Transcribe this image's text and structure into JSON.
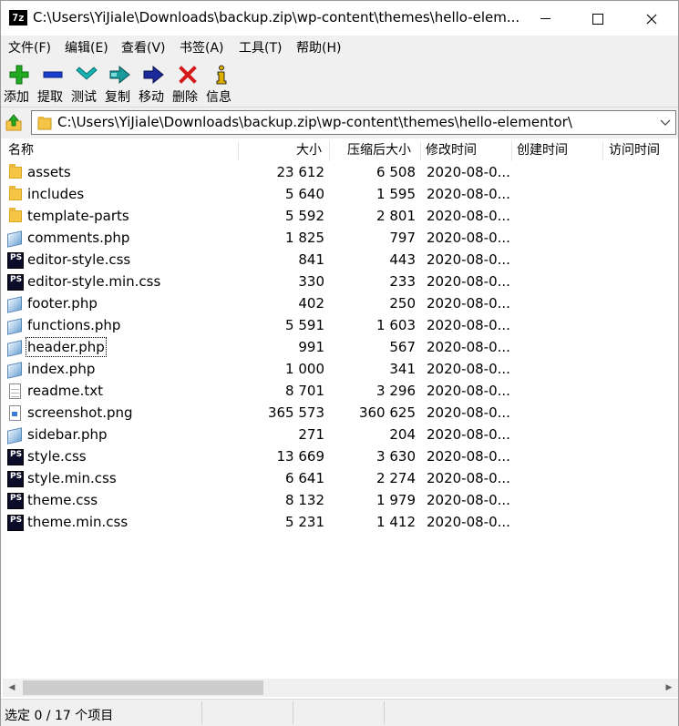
{
  "window": {
    "title": "C:\\Users\\YiJiale\\Downloads\\backup.zip\\wp-content\\themes\\hello-elem...",
    "app_icon_text": "7z"
  },
  "menu": [
    "文件(F)",
    "编辑(E)",
    "查看(V)",
    "书签(A)",
    "工具(T)",
    "帮助(H)"
  ],
  "toolbar": [
    {
      "label": "添加",
      "icon": "add-icon",
      "color": "#22aa22"
    },
    {
      "label": "提取",
      "icon": "extract-icon",
      "color": "#1a3fcf"
    },
    {
      "label": "测试",
      "icon": "test-icon",
      "color": "#17b3b3"
    },
    {
      "label": "复制",
      "icon": "copy-icon",
      "color": "#1a8a8a"
    },
    {
      "label": "移动",
      "icon": "move-icon",
      "color": "#1a2a9a"
    },
    {
      "label": "删除",
      "icon": "delete-icon",
      "color": "#d41a1a"
    },
    {
      "label": "信息",
      "icon": "info-icon",
      "color": "#d4a400"
    }
  ],
  "address": {
    "path": "C:\\Users\\YiJiale\\Downloads\\backup.zip\\wp-content\\themes\\hello-elementor\\"
  },
  "columns": [
    "名称",
    "大小",
    "压缩后大小",
    "修改时间",
    "创建时间",
    "访问时间"
  ],
  "files": [
    {
      "name": "assets",
      "size": "23 612",
      "packed": "6 508",
      "modified": "2020-08-0...",
      "icon": "folder-icon"
    },
    {
      "name": "includes",
      "size": "5 640",
      "packed": "1 595",
      "modified": "2020-08-0...",
      "icon": "folder-icon"
    },
    {
      "name": "template-parts",
      "size": "5 592",
      "packed": "2 801",
      "modified": "2020-08-0...",
      "icon": "folder-icon"
    },
    {
      "name": "comments.php",
      "size": "1 825",
      "packed": "797",
      "modified": "2020-08-0...",
      "icon": "php-file-icon"
    },
    {
      "name": "editor-style.css",
      "size": "841",
      "packed": "443",
      "modified": "2020-08-0...",
      "icon": "css-file-icon"
    },
    {
      "name": "editor-style.min.css",
      "size": "330",
      "packed": "233",
      "modified": "2020-08-0...",
      "icon": "css-file-icon"
    },
    {
      "name": "footer.php",
      "size": "402",
      "packed": "250",
      "modified": "2020-08-0...",
      "icon": "php-file-icon"
    },
    {
      "name": "functions.php",
      "size": "5 591",
      "packed": "1 603",
      "modified": "2020-08-0...",
      "icon": "php-file-icon"
    },
    {
      "name": "header.php",
      "size": "991",
      "packed": "567",
      "modified": "2020-08-0...",
      "icon": "php-file-icon"
    },
    {
      "name": "index.php",
      "size": "1 000",
      "packed": "341",
      "modified": "2020-08-0...",
      "icon": "php-file-icon"
    },
    {
      "name": "readme.txt",
      "size": "8 701",
      "packed": "3 296",
      "modified": "2020-08-0...",
      "icon": "text-file-icon"
    },
    {
      "name": "screenshot.png",
      "size": "365 573",
      "packed": "360 625",
      "modified": "2020-08-0...",
      "icon": "image-file-icon"
    },
    {
      "name": "sidebar.php",
      "size": "271",
      "packed": "204",
      "modified": "2020-08-0...",
      "icon": "php-file-icon"
    },
    {
      "name": "style.css",
      "size": "13 669",
      "packed": "3 630",
      "modified": "2020-08-0...",
      "icon": "css-file-icon"
    },
    {
      "name": "style.min.css",
      "size": "6 641",
      "packed": "2 274",
      "modified": "2020-08-0...",
      "icon": "css-file-icon"
    },
    {
      "name": "theme.css",
      "size": "8 132",
      "packed": "1 979",
      "modified": "2020-08-0...",
      "icon": "css-file-icon"
    },
    {
      "name": "theme.min.css",
      "size": "5 231",
      "packed": "1 412",
      "modified": "2020-08-0...",
      "icon": "css-file-icon"
    }
  ],
  "focused_file": "header.php",
  "status": {
    "text": "选定 0 / 17 个项目"
  }
}
